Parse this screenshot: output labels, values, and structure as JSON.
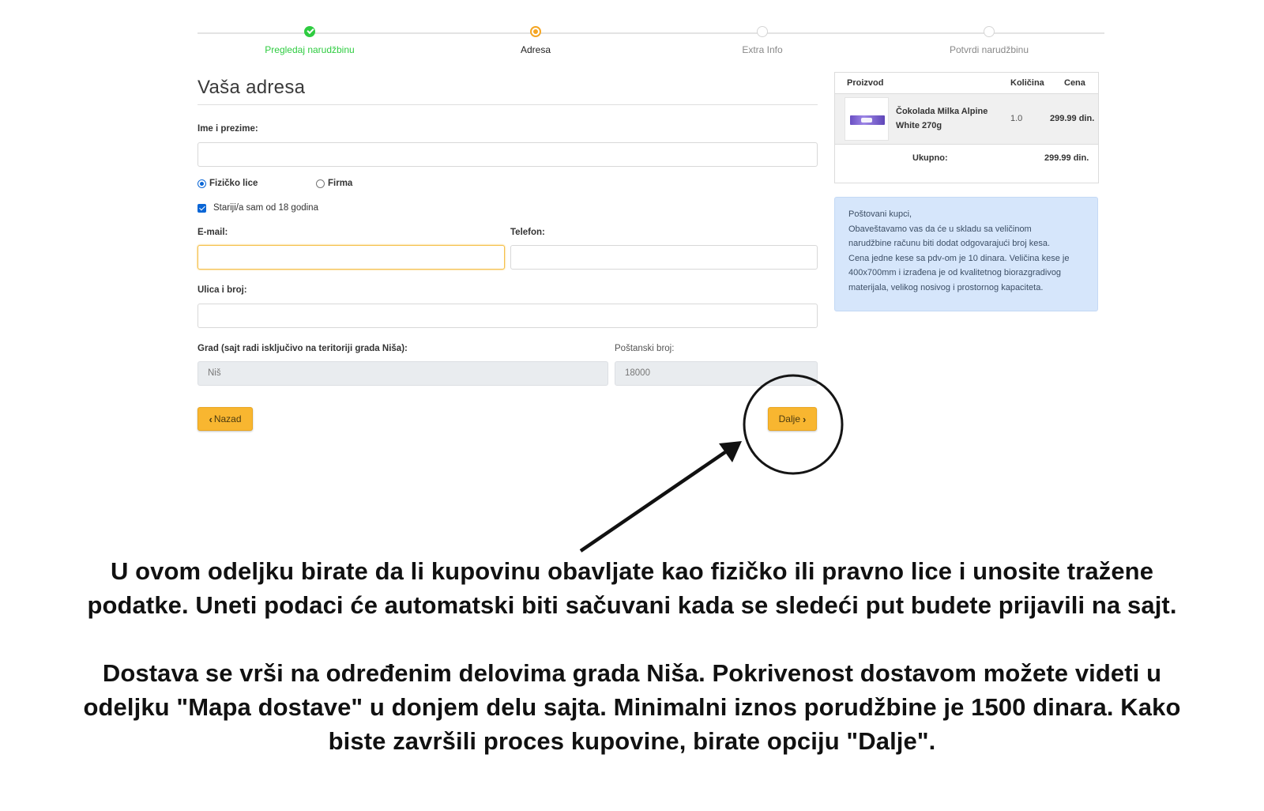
{
  "stepper": {
    "steps": [
      {
        "label": "Pregledaj narudžbinu",
        "state": "done"
      },
      {
        "label": "Adresa",
        "state": "active"
      },
      {
        "label": "Extra Info",
        "state": "idle"
      },
      {
        "label": "Potvrdi narudžbinu",
        "state": "idle"
      }
    ]
  },
  "form": {
    "title": "Vaša adresa",
    "name_label": "Ime i prezime:",
    "name_value": "",
    "type_options": [
      "Fizičko lice",
      "Firma"
    ],
    "type_selected": "Fizičko lice",
    "age_checkbox_label": "Stariji/a sam od 18 godina",
    "age_checked": true,
    "email_label": "E-mail:",
    "email_value": "",
    "phone_label": "Telefon:",
    "phone_value": "",
    "street_label": "Ulica i broj:",
    "street_value": "",
    "city_label": "Grad (sajt radi isključivo na teritoriji grada Niša):",
    "city_value": "Niš",
    "postal_label": "Poštanski broj:",
    "postal_value": "18000",
    "back_button": "Nazad",
    "next_button": "Dalje"
  },
  "cart": {
    "headers": {
      "product": "Proizvod",
      "quantity": "Količina",
      "price": "Cena"
    },
    "items": [
      {
        "name_line1": "Čokolada Milka Alpine",
        "name_line2": "White 270g",
        "quantity": "1.0",
        "price": "299.99 din."
      }
    ],
    "total_label": "Ukupno:",
    "total_value": "299.99 din."
  },
  "notice": {
    "lines": [
      "Poštovani kupci,",
      "Obaveštavamo vas da će u skladu sa veličinom",
      "narudžbine računu biti dodat odgovarajući broj kesa.",
      "Cena jedne kese sa pdv-om je 10 dinara. Veličina kese je",
      "400x700mm i izrađena je od kvalitetnog biorazgradivog",
      "materijala, velikog nosivog i prostornog kapaciteta."
    ]
  },
  "annotation": {
    "paragraph1_line1": "U ovom odeljku birate da li kupovinu obavljate kao fizičko ili pravno lice i unosite tražene",
    "paragraph1_line2": "podatke. Uneti podaci će automatski biti sačuvani kada se sledeći put budete prijavili na sajt.",
    "paragraph2_line1": "Dostava se vrši na određenim delovima grada Niša. Pokrivenost dostavom možete videti u",
    "paragraph2_line2": "odeljku \"Mapa dostave\" u donjem delu sajta. Minimalni iznos porudžbine je 1500 dinara. Kako",
    "paragraph2_line3": "biste završili proces kupovine, birate opciju \"Dalje\"."
  },
  "colors": {
    "accent": "#f8b630",
    "success": "#2ecc40",
    "notice_bg": "#d6e6fb"
  }
}
